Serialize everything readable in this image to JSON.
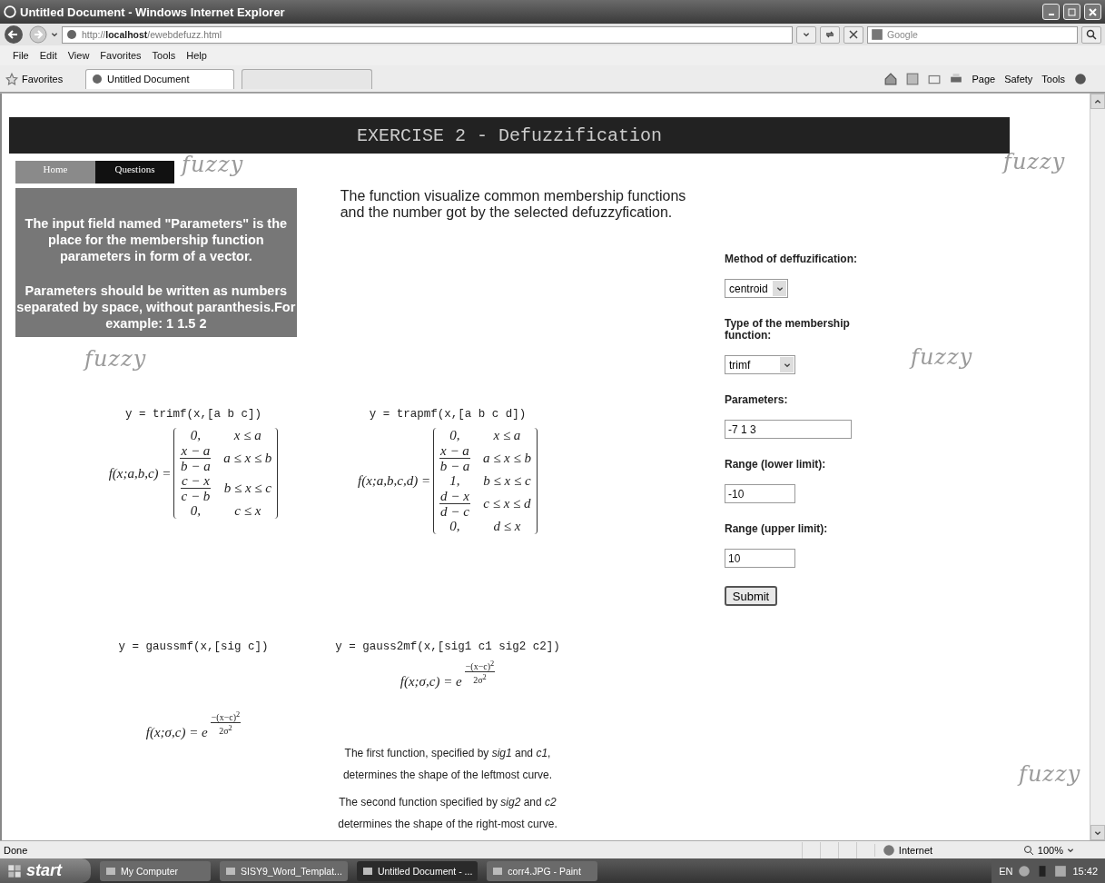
{
  "window": {
    "title": "Untitled Document - Windows Internet Explorer"
  },
  "address_bar": {
    "url": "http://**localhost**/ewebdefuzz.html"
  },
  "search": {
    "placeholder": "Google"
  },
  "menu": [
    "File",
    "Edit",
    "View",
    "Favorites",
    "Tools",
    "Help"
  ],
  "favorites_bar": {
    "favorites": "Favorites",
    "tabs": [
      {
        "label": "Untitled Document",
        "selected": true
      }
    ]
  },
  "command_bar": [
    "Page",
    "Safety",
    "Tools"
  ],
  "page": {
    "header": "EXERCISE 2 - Defuzzification",
    "nav": [
      {
        "label": "Home",
        "selected": false
      },
      {
        "label": "Questions",
        "selected": true
      }
    ],
    "info": [
      "The input field named \"Parameters\" is the place for the membership function parameters in form of a vector.",
      "Parameters should be written as numbers separated by space, without paranthesis.For example: 1 1.5 2"
    ],
    "description": "The function visualize common membership functions and the number got by the selected defuzzyfication.",
    "form": {
      "fields": [
        {
          "kind": "select",
          "label": "Method of deffuzification:",
          "value": "centroid"
        },
        {
          "kind": "select",
          "label": "Type of the membership function:",
          "value": "trimf"
        },
        {
          "kind": "text",
          "label": "Parameters:",
          "value": "-7 1 3"
        },
        {
          "kind": "text",
          "label": "Range (lower limit):",
          "value": "-10"
        },
        {
          "kind": "text",
          "label": "Range (upper limit):",
          "value": "10"
        }
      ],
      "submit": "Submit"
    },
    "formulas": [
      {
        "kind": "piecewise",
        "call": "y = trimf(x,[a b c])",
        "lhs": "f(x;a,b,c) =",
        "cases": [
          {
            "kind": "text",
            "value": "0,",
            "condition": "x ≤ a"
          },
          {
            "kind": "fraction",
            "num": "x − a",
            "den": "b − a",
            "condition": "a ≤ x ≤ b"
          },
          {
            "kind": "fraction",
            "num": "c − x",
            "den": "c − b",
            "condition": "b ≤ x ≤ c"
          },
          {
            "kind": "text",
            "value": "0,",
            "condition": "c ≤ x"
          }
        ]
      },
      {
        "kind": "piecewise",
        "call": "y = trapmf(x,[a b c d])",
        "lhs": "f(x;a,b,c,d) =",
        "cases": [
          {
            "kind": "text",
            "value": "0,",
            "condition": "x ≤ a"
          },
          {
            "kind": "fraction",
            "num": "x − a",
            "den": "b − a",
            "condition": "a ≤ x ≤ b"
          },
          {
            "kind": "text",
            "value": "1,",
            "condition": "b ≤ x ≤ c"
          },
          {
            "kind": "fraction",
            "num": "d − x",
            "den": "d − c",
            "condition": "c ≤ x ≤ d"
          },
          {
            "kind": "text",
            "value": "0,",
            "condition": "d ≤ x"
          }
        ]
      },
      {
        "kind": "exponential",
        "call": "y = gaussmf(x,[sig c])",
        "lhs": "f(x;σ,c) = e",
        "num": "−(x−c)$^{2}$",
        "den": "2σ$^{2}$"
      },
      {
        "kind": "exponential",
        "call": "y = gauss2mf(x,[sig1 c1 sig2 c2])",
        "lhs": "f(x;σ,c) = e",
        "num": "−(x−c)$^{2}$",
        "den": "2σ$^{2}$",
        "notes": [
          "The first function, specified by *sig1* and *c1*, determines the shape of the leftmost curve.",
          "The second function specified by *sig2* and *c2* determines the shape of the right-most curve."
        ]
      }
    ],
    "decorations": [
      "fuzzy",
      "fuzzy",
      "fuzzy",
      "fuzzy",
      "fuzzy"
    ]
  },
  "status_bar": {
    "status": "Done",
    "zone": "Internet",
    "zoom": "100%"
  },
  "taskbar": {
    "start": "start",
    "items": [
      {
        "label": "My Computer",
        "selected": false
      },
      {
        "label": "SISY9_Word_Templat...",
        "selected": false
      },
      {
        "label": "Untitled Document - ...",
        "selected": true
      },
      {
        "label": "corr4.JPG - Paint",
        "selected": false
      }
    ],
    "language": "EN",
    "clock": "15:42"
  }
}
